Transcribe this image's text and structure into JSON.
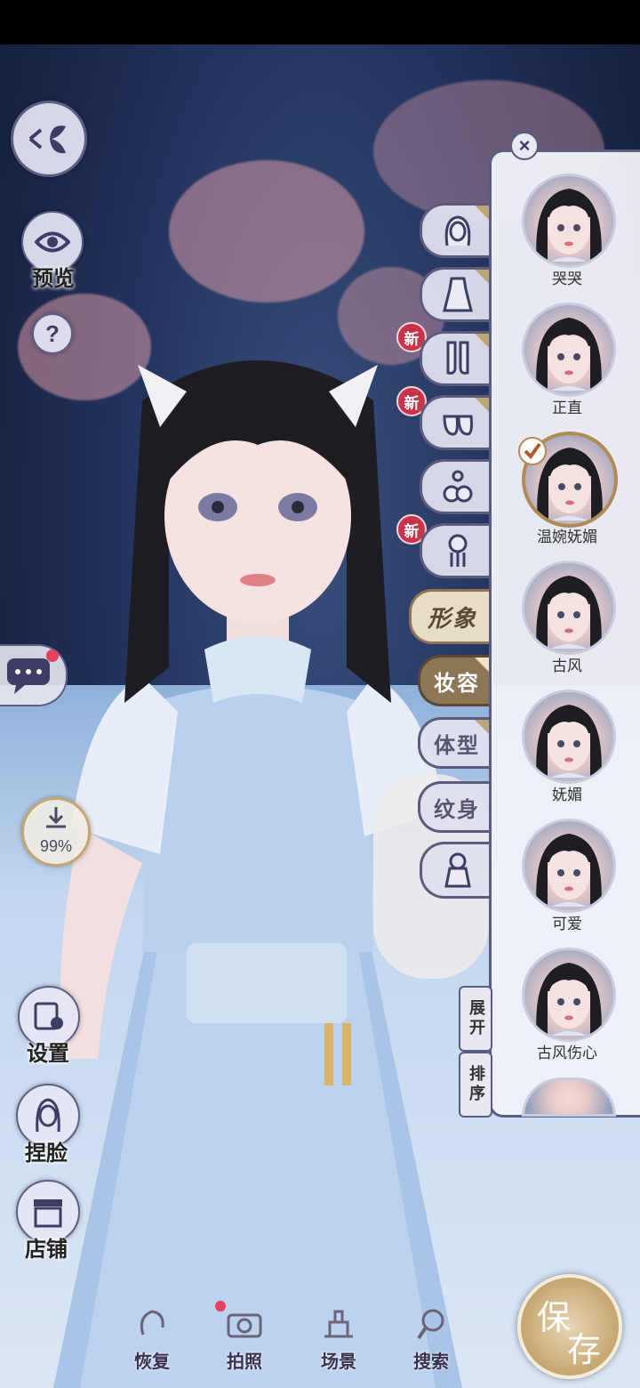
{
  "left_menu": {
    "preview_label": "预览",
    "help_label": "?",
    "download_percent": "99%",
    "settings_label": "设置",
    "face_label": "捏脸",
    "shop_label": "店铺"
  },
  "category_tabs": {
    "new_badge": "新",
    "appearance_label": "形象",
    "makeup_label": "妆容",
    "body_label": "体型",
    "tattoo_label": "纹身"
  },
  "makeup_panel": {
    "close_label": "×",
    "expand_label": "展开",
    "sort_label": "排序",
    "presets": [
      {
        "label": "哭哭"
      },
      {
        "label": "正直"
      },
      {
        "label": "温婉妩媚",
        "selected": true
      },
      {
        "label": "古风"
      },
      {
        "label": "妩媚"
      },
      {
        "label": "可爱"
      },
      {
        "label": "古风伤心"
      }
    ]
  },
  "bottom_bar": {
    "restore_label": "恢复",
    "photo_label": "拍照",
    "scene_label": "场景",
    "search_label": "搜索"
  },
  "save_button": {
    "char1": "保",
    "char2": "存"
  }
}
